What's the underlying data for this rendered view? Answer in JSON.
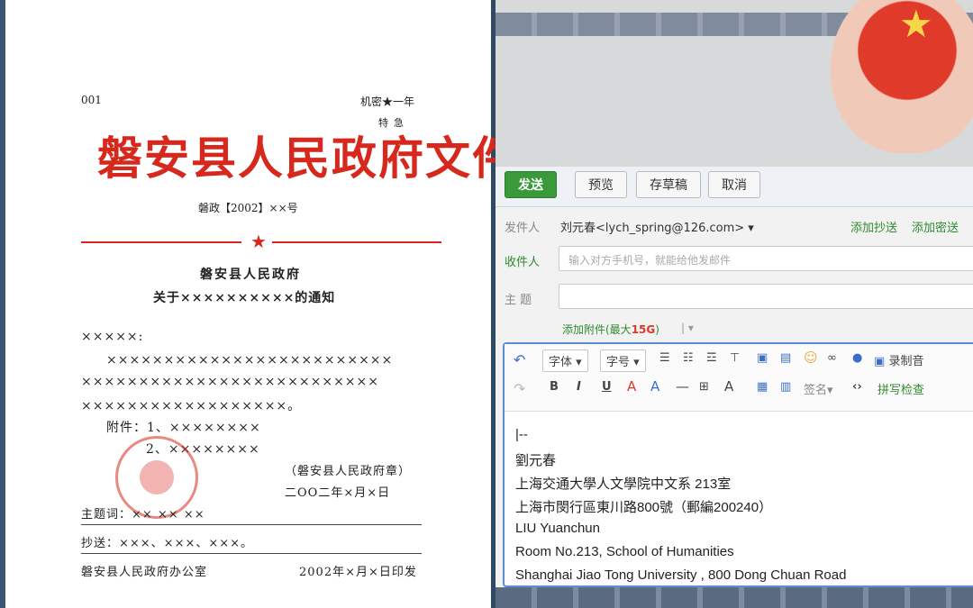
{
  "document": {
    "number": "001",
    "classification": "机密★一年",
    "urgency": "特急",
    "title": "磐安县人民政府文件",
    "issue_no": "磐政【2002】××号",
    "issuer": "磐安县人民政府",
    "subject": "关于××××××××××的通知",
    "salutation": "×××××:",
    "body_lines": [
      "×××××××××××××××××××××××××",
      "××××××××××××××××××××××××××",
      "××××××××××××××××××。"
    ],
    "attachments": [
      "附件：1、××××××××",
      "2、××××××××"
    ],
    "seal_text": "（磐安县人民政府章）",
    "date": "二OO二年×月×日",
    "keywords": "主题词：××  ××  ××",
    "cc": "抄送：×××、×××、×××。",
    "office": "磐安县人民政府办公室",
    "print_date": "2002年×月×日印发"
  },
  "email": {
    "toolbar": {
      "send": "发送",
      "preview": "预览",
      "draft": "存草稿",
      "cancel": "取消"
    },
    "sender_label": "发件人",
    "sender_value": "刘元春<lych_spring@126.com> ▾",
    "add_cc": "添加抄送",
    "add_bcc": "添加密送",
    "recipient_label": "收件人",
    "recipient_placeholder": "输入对方手机号，就能给他发邮件",
    "subject_label": "主  题",
    "attachment_link": "添加附件(最大",
    "attachment_size": "15G",
    "attachment_tail": ")",
    "attachment_sep": "|  ▾",
    "editor": {
      "font": "字体 ▾",
      "size": "字号 ▾",
      "record": "录制音",
      "signature": "签名▾",
      "spellcheck": "拼写检查"
    },
    "signature_lines": [
      "|--",
      "劉元春",
      "上海交通大學人文學院中文系 213室",
      "上海市閔行區東川路800號（郵編200240）",
      "LIU Yuanchun",
      "Room No.213, School of Humanities",
      "Shanghai Jiao Tong University , 800 Dong Chuan Road"
    ]
  }
}
